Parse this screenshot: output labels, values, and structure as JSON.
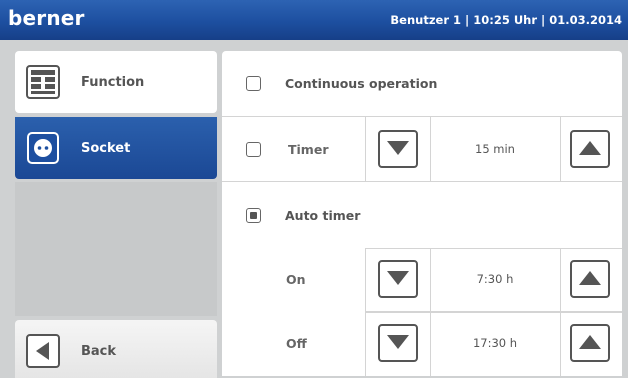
{
  "header": {
    "brand": "berner",
    "status": "Benutzer 1 | 10:25 Uhr | 01.03.2014"
  },
  "sidebar": {
    "items": [
      {
        "label": "Function",
        "icon": "function-grid-icon",
        "selected": false
      },
      {
        "label": "Socket",
        "icon": "socket-icon",
        "selected": true
      }
    ],
    "back_label": "Back"
  },
  "settings": {
    "continuous_operation": {
      "label": "Continuous operation",
      "checked": false
    },
    "timer": {
      "label": "Timer",
      "checked": false,
      "value": "15 min"
    },
    "auto_timer": {
      "label": "Auto timer",
      "checked": true,
      "on": {
        "label": "On",
        "value": "7:30 h"
      },
      "off": {
        "label": "Off",
        "value": "17:30 h"
      }
    }
  },
  "colors": {
    "header_blue": "#1d4fa0",
    "selected_blue": "#2b60ad",
    "background_gray": "#cfd1d2"
  }
}
